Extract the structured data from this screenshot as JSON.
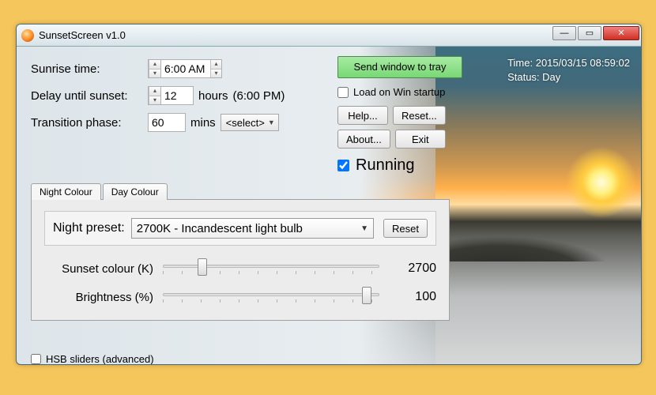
{
  "window": {
    "title": "SunsetScreen v1.0"
  },
  "inputs": {
    "sunrise_label": "Sunrise time:",
    "sunrise_value": "6:00 AM",
    "delay_label": "Delay until sunset:",
    "delay_value": "12",
    "delay_unit": "hours",
    "delay_paren": "(6:00 PM)",
    "transition_label": "Transition phase:",
    "transition_value": "60",
    "transition_unit": "mins",
    "transition_select": "<select>"
  },
  "side": {
    "tray_btn": "Send window to tray",
    "load_startup": "Load on Win startup",
    "help_btn": "Help...",
    "reset_btn": "Reset...",
    "about_btn": "About...",
    "exit_btn": "Exit",
    "running_label": "Running"
  },
  "status": {
    "time": "Time: 2015/03/15 08:59:02",
    "mode": "Status: Day"
  },
  "tabs": {
    "night": "Night Colour",
    "day": "Day Colour"
  },
  "panel": {
    "preset_label": "Night preset:",
    "preset_value": "2700K - Incandescent light bulb",
    "preset_reset": "Reset",
    "sunset_label": "Sunset colour (K)",
    "sunset_value": "2700",
    "brightness_label": "Brightness (%)",
    "brightness_value": "100",
    "sunset_thumb_pct": 16,
    "brightness_thumb_pct": 92
  },
  "hsb_label": "HSB sliders (advanced)"
}
